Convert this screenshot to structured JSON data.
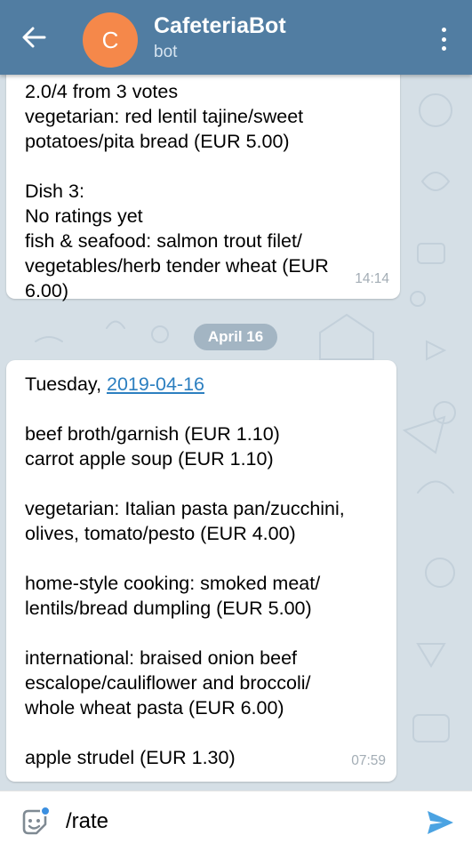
{
  "header": {
    "avatar_letter": "C",
    "title": "CafeteriaBot",
    "subtitle": "bot",
    "avatar_color": "#f5884a",
    "bar_color": "#517da2"
  },
  "messages": [
    {
      "text": "2.0/4 from 3 votes\nvegetarian: red lentil tajine/sweet\npotatoes/pita bread (EUR 5.00)\n\nDish 3:\nNo ratings yet\nfish & seafood: salmon trout filet/\nvegetables/herb tender wheat (EUR\n6.00)",
      "time": "14:14"
    },
    {
      "date_pill": "April 16"
    },
    {
      "day_prefix": "Tuesday, ",
      "date_link": "2019-04-16",
      "text": "\n\nbeef broth/garnish (EUR 1.10)\ncarrot apple soup (EUR 1.10)\n\nvegetarian: Italian pasta pan/zucchini,\nolives, tomato/pesto (EUR 4.00)\n\nhome-style cooking: smoked meat/\nlentils/bread dumpling (EUR 5.00)\n\ninternational: braised onion beef\nescalope/cauliflower and broccoli/\nwhole wheat pasta (EUR 6.00)\n\napple strudel (EUR 1.30)",
      "time": "07:59"
    }
  ],
  "input": {
    "value": "/rate"
  },
  "icons": {
    "back": "arrow-left-icon",
    "menu": "more-vertical-icon",
    "emoji": "sticker-face-icon",
    "send": "send-icon"
  }
}
